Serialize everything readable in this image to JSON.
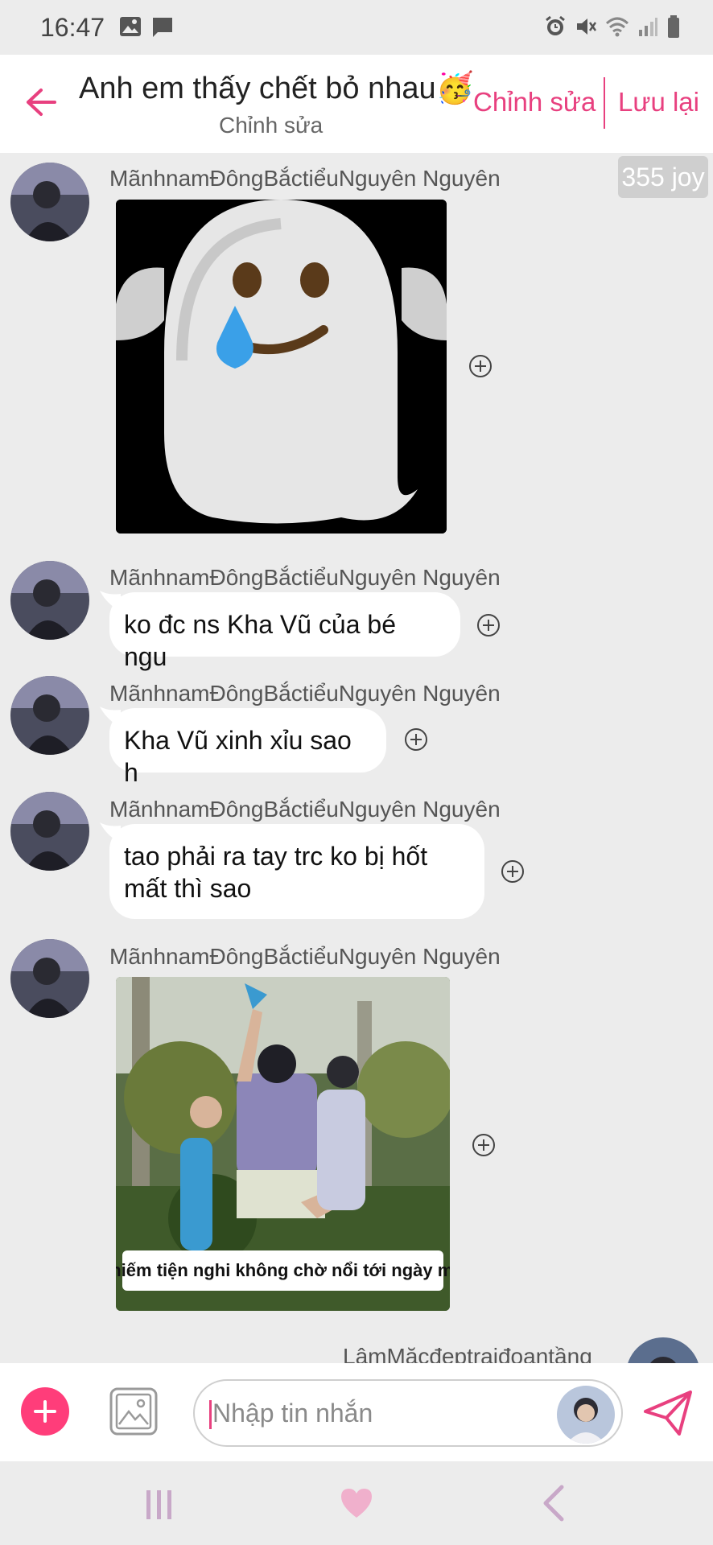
{
  "status": {
    "time": "16:47"
  },
  "header": {
    "title": "Anh em thấy chết bỏ nhau🥳",
    "subtitle": "Chỉnh sửa",
    "edit_label": "Chỉnh sửa",
    "save_label": "Lưu lại"
  },
  "joy_badge": "355 joy",
  "messages": [
    {
      "sender": "MãnhnamĐôngBắctiểuNguyên Nguyên",
      "type": "sticker",
      "content": "ghost-crying-sticker"
    },
    {
      "sender": "MãnhnamĐôngBắctiểuNguyên Nguyên",
      "type": "text",
      "text": "ko đc ns Kha Vũ của bé ngu"
    },
    {
      "sender": "MãnhnamĐôngBắctiểuNguyên Nguyên",
      "type": "text",
      "text": "Kha Vũ xinh xỉu sao h"
    },
    {
      "sender": "MãnhnamĐôngBắctiểuNguyên Nguyên",
      "type": "text",
      "text_line1": "tao phải ra tay trc ko bị hốt",
      "text_line2": "mất thì sao"
    },
    {
      "sender": "MãnhnamĐôngBắctiểuNguyên Nguyên",
      "type": "image",
      "caption": "Chiếm tiện nghi không chờ nổi tới ngày mai"
    },
    {
      "sender": "LâmMặcđeptraiđoantầng",
      "type": "partial"
    }
  ],
  "input": {
    "placeholder": "Nhập tin nhắn"
  },
  "icons": {
    "back": "back-arrow-icon",
    "add": "plus-icon",
    "image": "image-icon",
    "send": "send-icon",
    "react": "plus-circle-icon"
  },
  "colors": {
    "accent": "#e8407f",
    "add_button": "#ff3d7a",
    "background": "#ececec",
    "bubble": "#ffffff"
  }
}
